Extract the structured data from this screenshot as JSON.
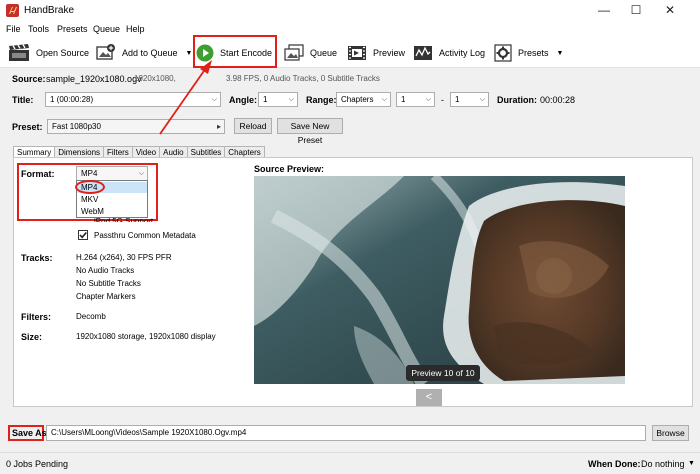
{
  "window": {
    "title": "HandBrake",
    "minimize": "—",
    "maximize": "☐",
    "close": "✕"
  },
  "menu": [
    "File",
    "Tools",
    "Presets",
    "Queue",
    "Help"
  ],
  "toolbar": {
    "open_source": "Open Source",
    "add_to_queue": "Add to Queue",
    "start_encode": "Start Encode",
    "queue": "Queue",
    "preview": "Preview",
    "activity_log": "Activity Log",
    "presets": "Presets"
  },
  "source": {
    "label": "Source:",
    "name": "sample_1920x1080.ogv",
    "info_left": "1920x1080,",
    "info_right": "3.98 FPS, 0 Audio Tracks, 0 Subtitle Tracks"
  },
  "title_row": {
    "title_label": "Title:",
    "title_value": "1 (00:00:28)",
    "angle_label": "Angle:",
    "angle_value": "1",
    "range_label": "Range:",
    "range_mode": "Chapters",
    "range_from": "1",
    "range_dash": "-",
    "range_to": "1",
    "duration_label": "Duration:",
    "duration_value": "00:00:28"
  },
  "preset": {
    "label": "Preset:",
    "value": "Fast 1080p30",
    "reload": "Reload",
    "save_new": "Save New Preset"
  },
  "tabs": [
    "Summary",
    "Dimensions",
    "Filters",
    "Video",
    "Audio",
    "Subtitles",
    "Chapters"
  ],
  "summary": {
    "format_label": "Format:",
    "format_value": "MP4",
    "format_options": [
      "MP4",
      "MKV",
      "WebM"
    ],
    "ipod_support": "iPod 5G Support",
    "passthru": "Passthru Common Metadata",
    "tracks_label": "Tracks:",
    "tracks": [
      "H.264 (x264), 30 FPS PFR",
      "No Audio Tracks",
      "No Subtitle Tracks",
      "Chapter Markers"
    ],
    "filters_label": "Filters:",
    "filters_value": "Decomb",
    "size_label": "Size:",
    "size_value": "1920x1080 storage, 1920x1080 display",
    "source_preview_label": "Source Preview:",
    "preview_badge": "Preview 10 of 10",
    "prev_button": "<"
  },
  "save": {
    "label": "Save As:",
    "path": "C:\\Users\\MLoong\\Videos\\Sample 1920X1080.Ogv.mp4",
    "browse": "Browse"
  },
  "status": {
    "jobs": "0 Jobs Pending",
    "when_done_label": "When Done:",
    "when_done_value": "Do nothing"
  },
  "colors": {
    "highlight": "#e0201b",
    "play_green": "#3f9e31",
    "selection": "#cce4f7"
  }
}
